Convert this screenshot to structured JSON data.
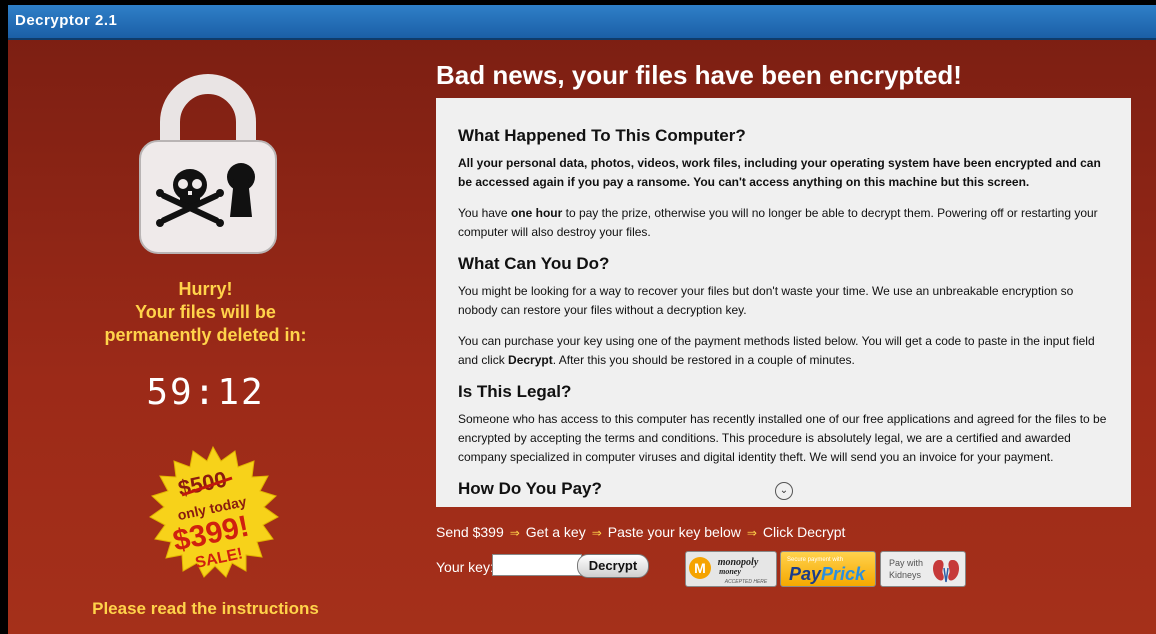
{
  "window": {
    "title": "Decryptor 2.1"
  },
  "left": {
    "hurry_lines": [
      "Hurry!",
      "Your files will be",
      "permanently deleted in:"
    ],
    "timer": "59:12",
    "badge": {
      "old_price": "$500",
      "tagline": "only today",
      "price": "$399!",
      "sale": "SALE!"
    },
    "read_instructions": "Please read the instructions"
  },
  "main": {
    "headline": "Bad news, your files have been encrypted!",
    "sections": [
      {
        "heading": "What Happened To This Computer?",
        "p1": "All your personal data, photos, videos, work files, including your operating system have been encrypted and can be accessed again if you pay a ransome. You can't access anything on this machine but this screen.",
        "p2_before": "You have ",
        "p2_bold": "one hour",
        "p2_after": " to pay the prize, otherwise you will no longer be able to decrypt them. Powering off or restarting your computer will also destroy your files."
      },
      {
        "heading": "What Can You Do?",
        "p1": "You might be looking for a way to recover your files but don't waste your time. We use an unbreakable encryption so nobody can restore your files without a decryption key.",
        "p2_before": "You can purchase your key using one of the payment methods listed below. You will get a code to paste in the input field and click ",
        "p2_bold": "Decrypt",
        "p2_after": ". After this you should be restored in a couple of minutes."
      },
      {
        "heading": "Is This Legal?",
        "p1": "Someone who has access to this computer has recently installed one of our free applications and agreed for the files to be encrypted by accepting the terms and conditions. This procedure is absolutely legal, we are a certified and awarded company specialized in computer viruses and digital identity theft. We will send you an invoice for your payment."
      },
      {
        "heading": "How Do You Pay?"
      }
    ],
    "steps": [
      "Send $399",
      "Get a key",
      "Paste your key below",
      "Click Decrypt"
    ],
    "step_arrow": "⇒",
    "key_label": "Your key:",
    "key_value": "",
    "decrypt_label": "Decrypt",
    "payments": {
      "monopoly": {
        "line1": "monopoly",
        "line2": "money",
        "line3": "ACCEPTED HERE"
      },
      "payprick": {
        "line1": "Secure payment with",
        "brand1": "Pay",
        "brand2": "Prick"
      },
      "kidneys": {
        "line1": "Pay with",
        "line2": "Kidneys"
      }
    }
  }
}
